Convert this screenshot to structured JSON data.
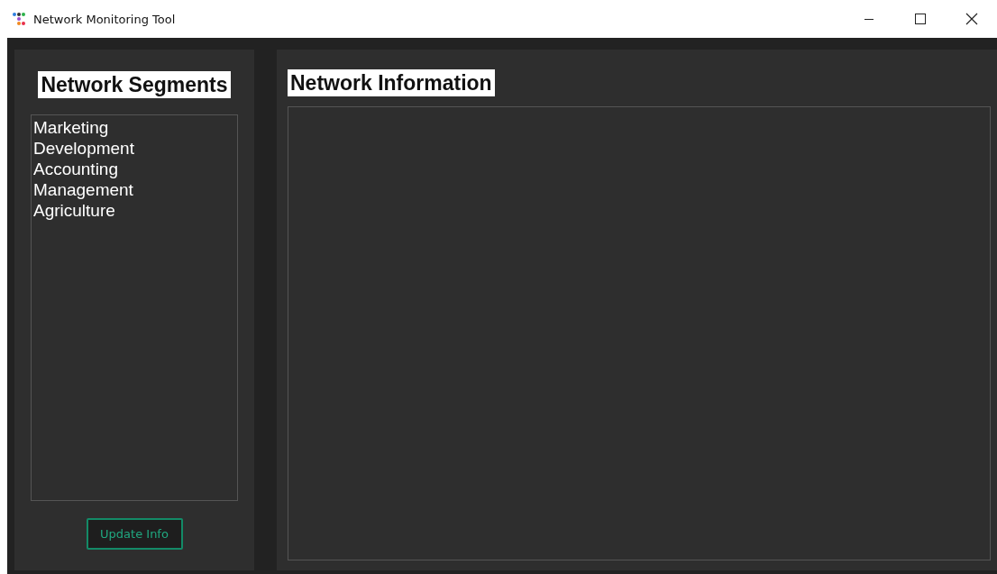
{
  "window": {
    "title": "Network Monitoring Tool"
  },
  "segments": {
    "title": "Network Segments",
    "items": [
      {
        "label": "Marketing",
        "selected": false
      },
      {
        "label": "Development",
        "selected": false
      },
      {
        "label": "Accounting",
        "selected": false
      },
      {
        "label": "Management",
        "selected": false
      },
      {
        "label": "Agriculture",
        "selected": false
      }
    ],
    "button": "Update Info"
  },
  "info": {
    "title": "Network Information"
  }
}
